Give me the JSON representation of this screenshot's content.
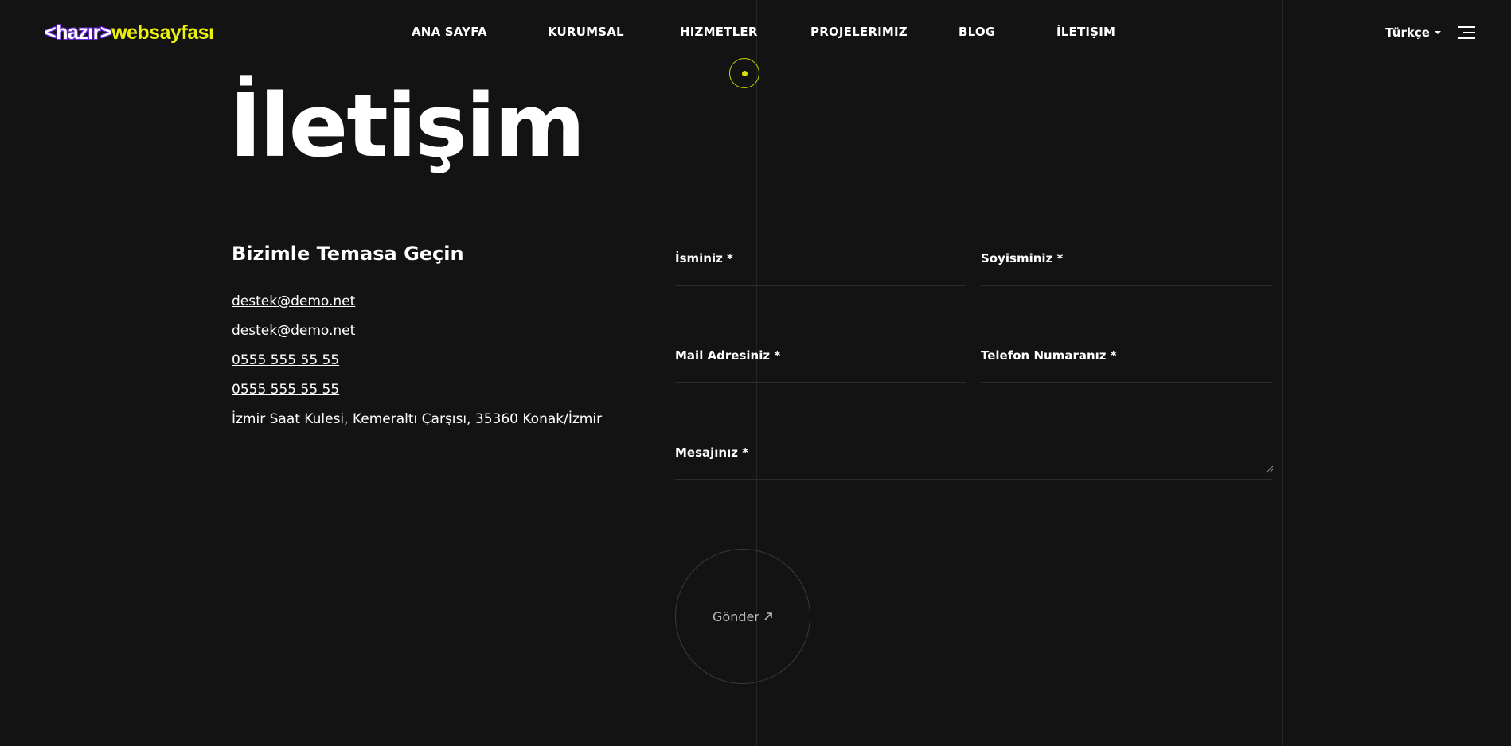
{
  "brand": {
    "prefix": "<hazır>",
    "name": "websayfası"
  },
  "nav": {
    "items": [
      {
        "label": "ANA SAYFA"
      },
      {
        "label": "KURUMSAL"
      },
      {
        "label": "HIZMETLER"
      },
      {
        "label": "PROJELERIMIZ"
      },
      {
        "label": "BLOG"
      },
      {
        "label": "İLETIŞIM"
      }
    ]
  },
  "language": {
    "selected": "Türkçe"
  },
  "page": {
    "title": "İletişim"
  },
  "contact": {
    "heading": "Bizimle Temasa Geçin",
    "emails": [
      "destek@demo.net",
      "destek@demo.net"
    ],
    "phones": [
      "0555 555 55 55",
      "0555 555 55 55"
    ],
    "address": "İzmir Saat Kulesi, Kemeraltı Çarşısı, 35360 Konak/İzmir"
  },
  "form": {
    "first_name_label": "İsminiz *",
    "last_name_label": "Soyisminiz *",
    "email_label": "Mail Adresiniz *",
    "phone_label": "Telefon Numaranız *",
    "message_label": "Mesajınız *",
    "submit_label": "Gönder"
  },
  "colors": {
    "background": "#131313",
    "accent": "#ecf20a",
    "brand_purple": "#6a2bd8",
    "text": "#ffffff",
    "divider": "#252525"
  },
  "icons": [
    "menu-icon",
    "caret-down-icon",
    "arrow-up-right-icon"
  ]
}
